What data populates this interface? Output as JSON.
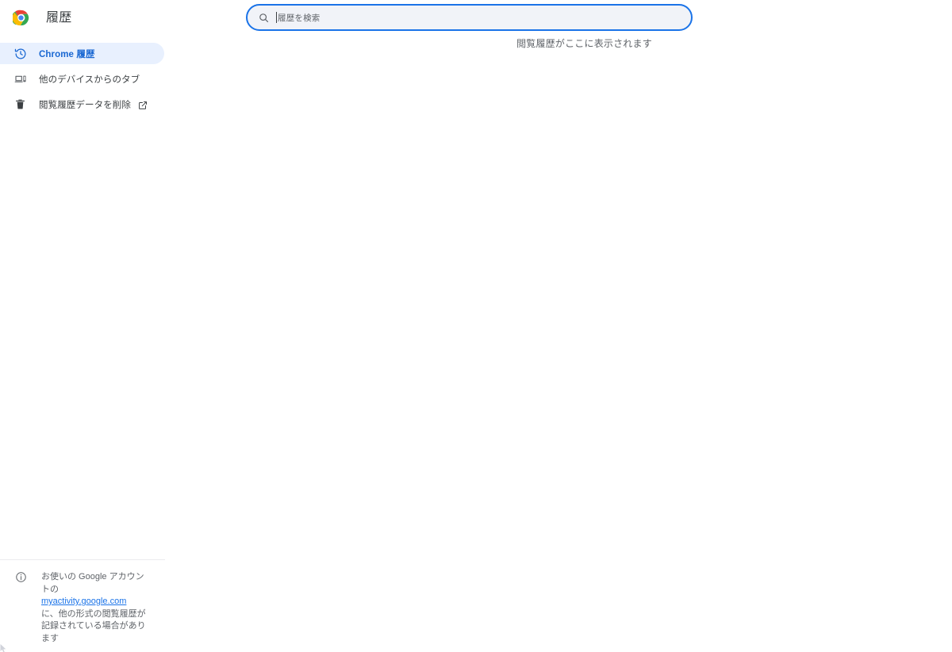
{
  "window": {
    "background": "#ffffff"
  },
  "sidebar": {
    "brand": {
      "title": "履歴",
      "logo_icon": "chrome-logo-icon"
    },
    "items": [
      {
        "id": "chrome-history",
        "label": "Chrome 履歴",
        "icon": "history-clock-icon",
        "active": true,
        "has_external_link": false
      },
      {
        "id": "tabs-from-other-devices",
        "label": "他のデバイスからのタブ",
        "icon": "devices-laptop-phone-icon",
        "active": false,
        "has_external_link": false
      },
      {
        "id": "clear-browsing-data",
        "label": "閲覧履歴データを削除",
        "icon": "trash-bin-icon",
        "active": false,
        "has_external_link": true,
        "external_link_icon": "open-in-new-icon"
      }
    ],
    "footer": {
      "icon": "info-circle-icon",
      "text_before_link": "お使いの Google アカウントの ",
      "link_text": "myactivity.google.com",
      "text_after_link": " に、他の形式の閲覧履歴が記録されている場合があります"
    }
  },
  "main": {
    "search": {
      "icon": "search-magnifier-icon",
      "placeholder": "履歴を検索",
      "value": "",
      "focused": true
    },
    "empty_state_text": "閲覧履歴がここに表示されます"
  },
  "colors": {
    "accent_blue": "#1a73e8",
    "active_pill_bg": "#e8f0fe",
    "active_text": "#1967d2",
    "primary_text": "#3c4043",
    "secondary_text": "#5f6368",
    "search_fill": "#f1f3f8",
    "divider": "#ebecee"
  }
}
